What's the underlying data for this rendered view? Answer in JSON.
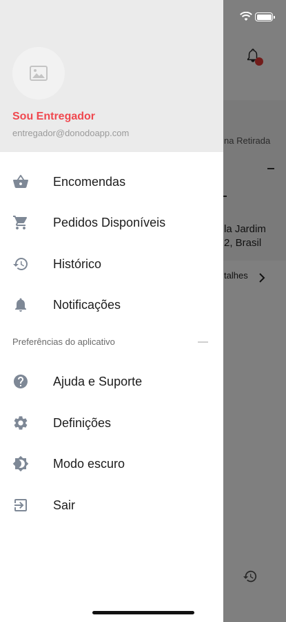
{
  "background": {
    "pickup_text": "na Retirada",
    "dash": "-",
    "address_line1": "la Jardim",
    "address_line2": "2, Brasil",
    "details_link": "talhes",
    "notification_badge_color": "#e53935"
  },
  "drawer": {
    "user": {
      "name": "Sou Entregador",
      "email": "entregador@donodoapp.com",
      "name_color": "#f0484f"
    },
    "menu": [
      {
        "label": "Encomendas",
        "icon": "basket-icon"
      },
      {
        "label": "Pedidos Disponíveis",
        "icon": "cart-icon"
      },
      {
        "label": "Histórico",
        "icon": "history-icon"
      },
      {
        "label": "Notificações",
        "icon": "bell-icon"
      }
    ],
    "section_title": "Preferências do aplicativo",
    "preferences": [
      {
        "label": "Ajuda e Suporte",
        "icon": "help-icon"
      },
      {
        "label": "Definições",
        "icon": "gear-icon"
      },
      {
        "label": "Modo escuro",
        "icon": "dark-mode-icon"
      },
      {
        "label": "Sair",
        "icon": "logout-icon"
      }
    ]
  },
  "colors": {
    "icon_gray": "#7e8896",
    "accent": "#f0484f"
  }
}
